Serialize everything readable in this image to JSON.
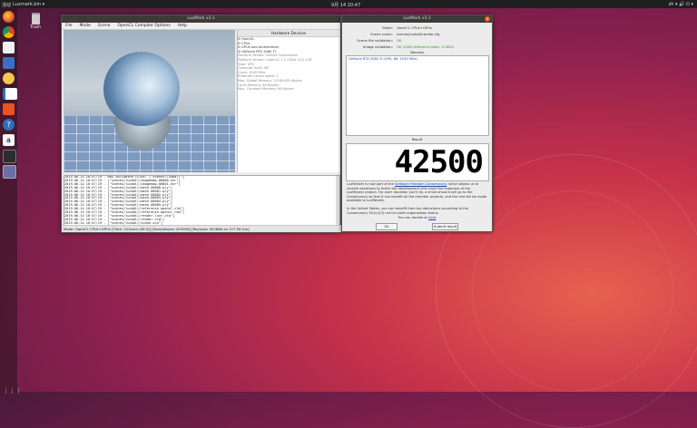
{
  "topbar": {
    "activities": "活动",
    "app": "Luxmark.bin ▾",
    "clock": "9月 14 10:47",
    "tray": "zh ▾  🔊  ⏻ ▾"
  },
  "desktop": {
    "trash_label": "Trash"
  },
  "dock": {
    "icons": [
      "firefox-icon",
      "chrome-icon",
      "files-icon",
      "mail-icon",
      "rhythmbox-icon",
      "writer-icon",
      "software-icon",
      "help-icon",
      "amazon-icon",
      "terminal-icon",
      "luxmark-icon"
    ]
  },
  "main_window": {
    "title": "LuxMark v3.1",
    "menu": [
      "File",
      "Mode",
      "Scene",
      "OpenCL Compiler Options",
      "Help"
    ],
    "tree_header": "Hardware Devices",
    "tree": [
      {
        "text": "⊟ OpenCL",
        "cls": ""
      },
      {
        "text": "   ⊟ CPUs",
        "cls": ""
      },
      {
        "text": "   ⊟ GPUs and Accelerators",
        "cls": ""
      },
      {
        "text": "      ☑ GeForce RTX 2080 Ti",
        "cls": ""
      },
      {
        "text": "         Platform Vendor: NVIDIA Corporation",
        "cls": "sub"
      },
      {
        "text": "         Platform Version: OpenCL 1.2 CUDA 10.2.118",
        "cls": "sub"
      },
      {
        "text": "         Type: GPU",
        "cls": "sub"
      },
      {
        "text": "         Compute Units: 68",
        "cls": "sub"
      },
      {
        "text": "         Clock: 1545 MHz",
        "cls": "sub"
      },
      {
        "text": "         Preferred vector width: 1",
        "cls": "sub"
      },
      {
        "text": "         Max. Global Memory: 11165433 Kbytes",
        "cls": "sub"
      },
      {
        "text": "         Local Memory: 48 Kbytes",
        "cls": "sub"
      },
      {
        "text": "         Max. Constant Memory: 64 Kbytes",
        "cls": "sub"
      }
    ],
    "log": [
      "2019-06-14 10:47:19 - MD5 validated files: [\"scenes/luxball\"]",
      "2019-06-14 10:47:19 - [\"scenes/luxball/imagemap-00000.exr\"]",
      "2019-06-14 10:47:19 - [\"scenes/luxball/imagemap-00001.exr\"]",
      "2019-06-14 10:47:19 - [\"scenes/luxball/mesh-00000.ply\"]",
      "2019-06-14 10:47:19 - [\"scenes/luxball/mesh-00001.ply\"]",
      "2019-06-14 10:47:19 - [\"scenes/luxball/mesh-00002.ply\"]",
      "2019-06-14 10:47:19 - [\"scenes/luxball/mesh-00003.ply\"]",
      "2019-06-14 10:47:19 - [\"scenes/luxball/mesh-00004.ply\"]",
      "2019-06-14 10:47:19 - [\"scenes/luxball/mesh-00005.ply\"]",
      "2019-06-14 10:47:19 - [\"scenes/luxball/reference-opencl.cfg\"]",
      "2019-06-14 10:47:19 - [\"scenes/luxball/reference-opencl.raw\"]",
      "2019-06-14 10:47:19 - [\"scenes/luxball/render-luxr.cfg\"]",
      "2019-06-14 10:47:19 - [\"scenes/luxball/render.cfg\"]",
      "2019-06-14 10:47:19 - [\"scenes/luxball/scene.scn\"]",
      "2019-06-14 10:47:19 - Scene files MD5: 74c99c98ab0bab02fec9ea7cb73eab5f8"
    ],
    "status": "Mode: OpenCL CPUs+GPUs [Time: 121secs (00:0)] [Samples/sec  42500K] [Rays/sec  94268K on 217.5K tris]"
  },
  "result_window": {
    "title": "LuxMark v3.1",
    "fields": [
      {
        "key": "Mode:",
        "value": "OpenCL CPUs+GPUs",
        "ok": false
      },
      {
        "key": "Scene name:",
        "value": "scenes/luxball/render.cfg",
        "ok": false
      },
      {
        "key": "Scene file validation:",
        "value": "OK",
        "ok": true
      },
      {
        "key": "Image validation:",
        "value": "OK (4262 different pixels, 0.96%)",
        "ok": true
      }
    ],
    "devices_label": "Devices",
    "devices": "GeForce RTX 2080 Ti (GPU, 68, 1545 MHz)",
    "result_label": "Result",
    "score": "42500",
    "para1_a": "LuxRender is now part of the ",
    "para1_link": "Software Freedom Conservancy",
    "para1_b": ", which allows us to receive donations to foster the development and cover the expenses of the LuxRender project. For each donation you'll do, a small amount will go to the Conservancy so that it can benefit all the member projects, and the rest will be made available to LuxRender.",
    "para2": "In the United States, you can benefit from tax deductions according to the Conservancy 501(c)(3) not for profit organization status.",
    "para3_a": "You can donate at ",
    "para3_link": "here",
    "para3_b": ".",
    "ok_button": "Ok",
    "submit_button": "Submit result"
  }
}
